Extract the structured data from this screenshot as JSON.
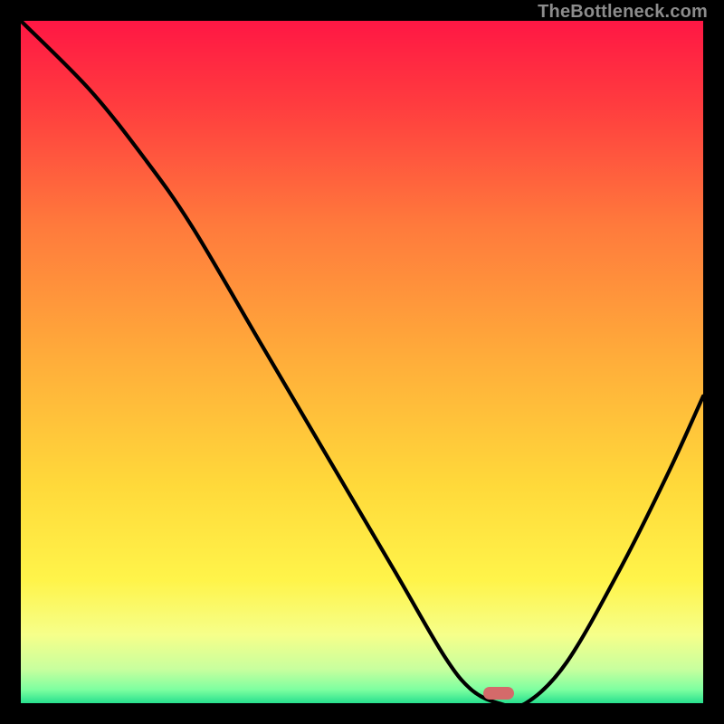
{
  "watermark": "TheBottleneck.com",
  "colors": {
    "gradient_stops": [
      {
        "offset": 0,
        "color": "#ff1744"
      },
      {
        "offset": 12,
        "color": "#ff3b3f"
      },
      {
        "offset": 30,
        "color": "#ff7a3c"
      },
      {
        "offset": 50,
        "color": "#ffae3a"
      },
      {
        "offset": 68,
        "color": "#ffd93a"
      },
      {
        "offset": 82,
        "color": "#fff44a"
      },
      {
        "offset": 90,
        "color": "#f6ff8a"
      },
      {
        "offset": 95,
        "color": "#c8ff9e"
      },
      {
        "offset": 98,
        "color": "#7effa0"
      },
      {
        "offset": 100,
        "color": "#27e08e"
      }
    ],
    "curve_stroke": "#000000",
    "marker_fill": "#d46a6a",
    "frame_bg": "#000000"
  },
  "chart_data": {
    "type": "line",
    "title": "",
    "xlabel": "",
    "ylabel": "",
    "xlim": [
      0,
      100
    ],
    "ylim": [
      0,
      100
    ],
    "series": [
      {
        "name": "bottleneck-curve",
        "x": [
          0,
          10,
          18,
          25,
          35,
          45,
          55,
          62,
          66,
          70,
          74,
          80,
          88,
          95,
          100
        ],
        "values": [
          100,
          90,
          80,
          70,
          53,
          36,
          19,
          7,
          2,
          0,
          0,
          6,
          20,
          34,
          45
        ]
      }
    ],
    "annotations": [
      {
        "name": "optimal-marker",
        "x": 70,
        "y": 1.5,
        "shape": "pill",
        "color": "#d46a6a"
      }
    ]
  }
}
